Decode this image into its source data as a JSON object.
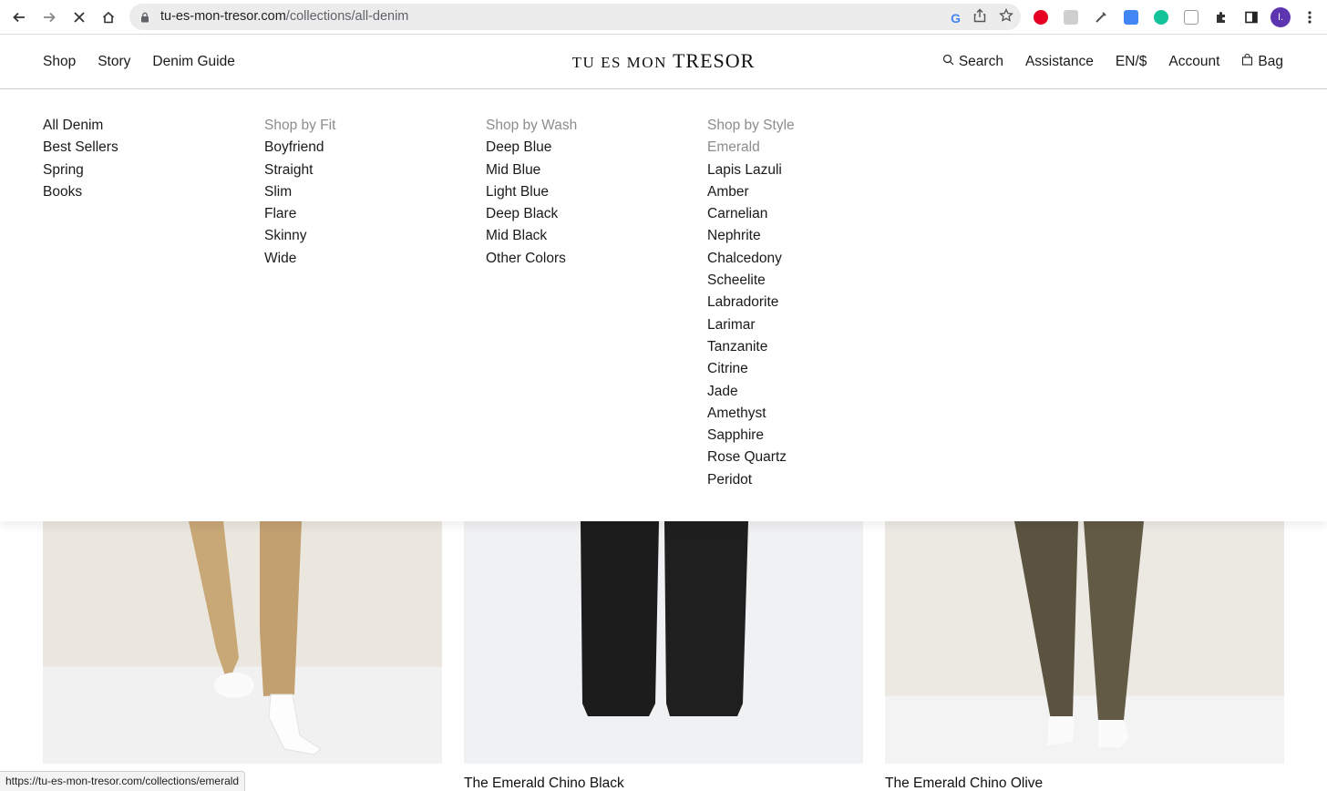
{
  "browser": {
    "url_domain": "tu-es-mon-tresor.com",
    "url_path": "/collections/all-denim",
    "profile_initial": "I.",
    "status_url": "https://tu-es-mon-tresor.com/collections/emerald"
  },
  "header": {
    "nav_left": [
      "Shop",
      "Story",
      "Denim Guide"
    ],
    "logo_small": "TU ES MON",
    "logo_large": "TRESOR",
    "search": "Search",
    "assistance": "Assistance",
    "currency": "EN/$",
    "account": "Account",
    "bag": "Bag"
  },
  "menu": {
    "col1": [
      "All Denim",
      "Best Sellers",
      "Spring",
      "Books"
    ],
    "fit_heading": "Shop by Fit",
    "fit": [
      "Boyfriend",
      "Straight",
      "Slim",
      "Flare",
      "Skinny",
      "Wide"
    ],
    "wash_heading": "Shop by Wash",
    "wash": [
      "Deep Blue",
      "Mid Blue",
      "Light Blue",
      "Deep Black",
      "Mid Black",
      "Other Colors"
    ],
    "style_heading": "Shop by Style",
    "style": [
      "Emerald",
      "Lapis Lazuli",
      "Amber",
      "Carnelian",
      "Nephrite",
      "Chalcedony",
      "Scheelite",
      "Labradorite",
      "Larimar",
      "Tanzanite",
      "Citrine",
      "Jade",
      "Amethyst",
      "Sapphire",
      "Rose Quartz",
      "Peridot"
    ]
  },
  "products": [
    {
      "title": ""
    },
    {
      "title": "The Emerald Chino Black"
    },
    {
      "title": "The Emerald Chino Olive"
    }
  ],
  "colors": {
    "profile": "#5e35b1",
    "heading_muted": "#8c8c8c"
  }
}
